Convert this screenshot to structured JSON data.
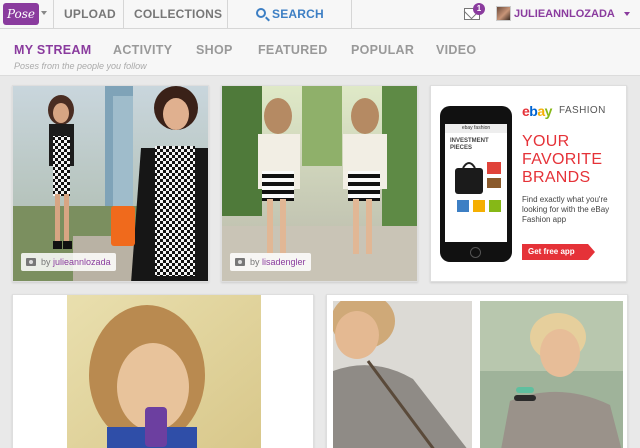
{
  "header": {
    "logo_text": "Pose",
    "nav": {
      "upload": "UPLOAD",
      "collections": "COLLECTIONS",
      "search": "SEARCH"
    },
    "notification_count": "1",
    "username": "JULIEANNLOZADA"
  },
  "stream_nav": {
    "tabs": [
      {
        "label": "MY STREAM",
        "active": true
      },
      {
        "label": "ACTIVITY",
        "active": false
      },
      {
        "label": "SHOP",
        "active": false
      },
      {
        "label": "FEATURED",
        "active": false
      },
      {
        "label": "POPULAR",
        "active": false
      },
      {
        "label": "VIDEO",
        "active": false
      }
    ],
    "caption": "Poses from the people you follow"
  },
  "feed": {
    "posts": [
      {
        "by_label": "by",
        "user": "julieannlozada"
      },
      {
        "by_label": "by",
        "user": "lisadengler"
      }
    ]
  },
  "ad": {
    "brand": "ebay",
    "brand_sub": "FASHION",
    "headline": "YOUR FAVORITE BRANDS",
    "copy": "Find exactly what you're looking for with the eBay Fashion app",
    "cta": "Get free app",
    "phone_header": "ebay fashion",
    "phone_title": "INVESTMENT PIECES"
  },
  "colors": {
    "accent": "#8a3b9e",
    "link": "#3d7fc4",
    "ebay_red": "#e53238"
  }
}
